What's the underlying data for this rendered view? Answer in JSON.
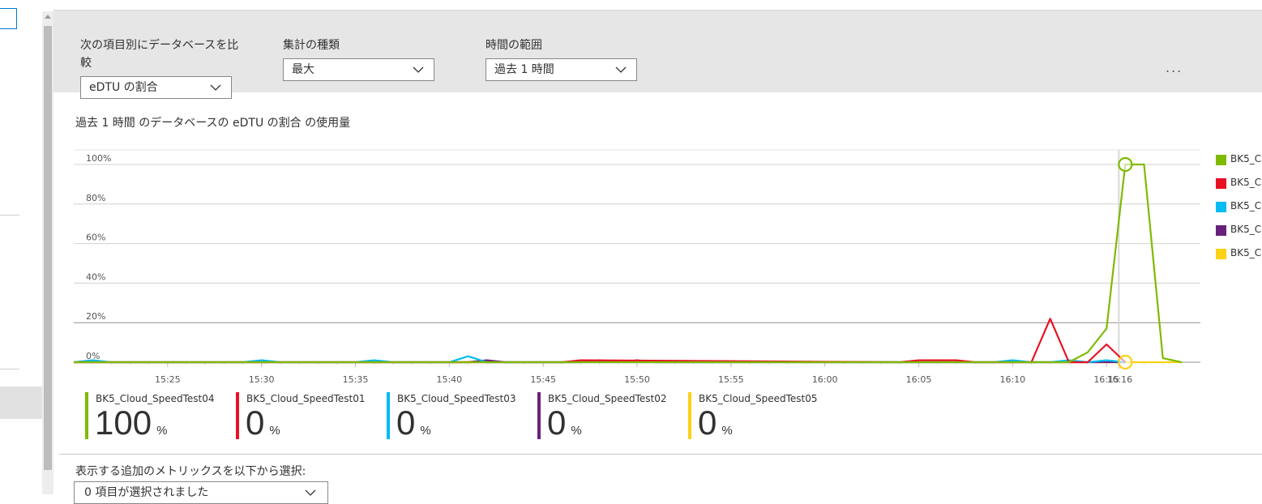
{
  "controls": {
    "compare": {
      "label": "次の項目別にデータベースを比較",
      "value": "eDTU の割合"
    },
    "aggregation": {
      "label": "集計の種類",
      "value": "最大"
    },
    "timerange": {
      "label": "時間の範囲",
      "value": "過去 1 時間"
    },
    "more": "..."
  },
  "chart_title": "過去 1 時間 のデータベースの eDTU の割合 の使用量",
  "chart_data": {
    "type": "line",
    "ylim": [
      0,
      100
    ],
    "yticks": [
      "100%",
      "80%",
      "60%",
      "40%",
      "20%",
      "0%"
    ],
    "xticks": [
      "15:25",
      "15:30",
      "15:35",
      "15:40",
      "15:45",
      "15:50",
      "15:55",
      "16:00",
      "16:05",
      "16:10",
      "16:15",
      "16:16"
    ],
    "cursor_label": "16:16",
    "grid": true,
    "legend_position": "right",
    "series": [
      {
        "name": "BK5_Cloud_SpeedTest04",
        "color": "#7fba00",
        "points": [
          [
            "15:20",
            0
          ],
          [
            "16:12",
            0
          ],
          [
            "16:13",
            0
          ],
          [
            "16:14",
            5
          ],
          [
            "16:15",
            17
          ],
          [
            "16:16",
            100
          ],
          [
            "16:17",
            100
          ],
          [
            "16:18",
            2
          ],
          [
            "16:19",
            0
          ]
        ]
      },
      {
        "name": "BK5_Cloud_SpeedTest01",
        "color": "#e81123",
        "points": [
          [
            "15:20",
            0
          ],
          [
            "15:46",
            0
          ],
          [
            "15:47",
            1
          ],
          [
            "16:04",
            0
          ],
          [
            "16:05",
            1
          ],
          [
            "16:07",
            1
          ],
          [
            "16:08",
            0
          ],
          [
            "16:11",
            0
          ],
          [
            "16:12",
            22
          ],
          [
            "16:13",
            0
          ],
          [
            "16:14",
            0
          ],
          [
            "16:15",
            9
          ],
          [
            "16:16",
            0
          ]
        ]
      },
      {
        "name": "BK5_Cloud_SpeedTest03",
        "color": "#00bcf2",
        "points": [
          [
            "15:20",
            0
          ],
          [
            "15:21",
            1
          ],
          [
            "15:22",
            0
          ],
          [
            "15:29",
            0
          ],
          [
            "15:30",
            1
          ],
          [
            "15:31",
            0
          ],
          [
            "15:35",
            0
          ],
          [
            "15:36",
            1
          ],
          [
            "15:37",
            0
          ],
          [
            "15:40",
            0
          ],
          [
            "15:41",
            3
          ],
          [
            "15:42",
            0
          ],
          [
            "16:09",
            0
          ],
          [
            "16:10",
            1
          ],
          [
            "16:11",
            0
          ],
          [
            "16:12",
            0
          ],
          [
            "16:13",
            1
          ],
          [
            "16:14",
            0
          ],
          [
            "16:15",
            1
          ],
          [
            "16:16",
            0
          ]
        ]
      },
      {
        "name": "BK5_Cloud_SpeedTest02",
        "color": "#68217a",
        "points": [
          [
            "15:20",
            0
          ],
          [
            "15:41",
            0
          ],
          [
            "15:42",
            1
          ],
          [
            "15:43",
            0
          ],
          [
            "15:47",
            0
          ],
          [
            "15:48",
            1
          ],
          [
            "15:49",
            0
          ],
          [
            "15:50",
            1
          ],
          [
            "15:51",
            0
          ],
          [
            "16:16",
            0
          ]
        ]
      },
      {
        "name": "BK5_Cloud_SpeedTest05",
        "color": "#fcd116",
        "points": [
          [
            "15:20",
            0
          ],
          [
            "16:19",
            0
          ]
        ]
      }
    ],
    "highlight": [
      {
        "series": "BK5_Cloud_SpeedTest04",
        "x": "16:16",
        "y": 100
      },
      {
        "series": "BK5_Cloud_SpeedTest05",
        "x": "16:16",
        "y": 0
      }
    ]
  },
  "legend": [
    {
      "label": "BK5_Cloud_SpeedTest04",
      "color": "#7fba00"
    },
    {
      "label": "BK5_Cloud_SpeedTest01",
      "color": "#e81123"
    },
    {
      "label": "BK5_Cloud_SpeedTest03",
      "color": "#00bcf2"
    },
    {
      "label": "BK5_Cloud_SpeedTest02",
      "color": "#68217a"
    },
    {
      "label": "BK5_Cloud_SpeedTest05",
      "color": "#fcd116"
    }
  ],
  "tiles": [
    {
      "name": "BK5_Cloud_SpeedTest04",
      "value": "100",
      "unit": "%",
      "color": "#7fba00"
    },
    {
      "name": "BK5_Cloud_SpeedTest01",
      "value": "0",
      "unit": "%",
      "color": "#e81123"
    },
    {
      "name": "BK5_Cloud_SpeedTest03",
      "value": "0",
      "unit": "%",
      "color": "#00bcf2"
    },
    {
      "name": "BK5_Cloud_SpeedTest02",
      "value": "0",
      "unit": "%",
      "color": "#68217a"
    },
    {
      "name": "BK5_Cloud_SpeedTest05",
      "value": "0",
      "unit": "%",
      "color": "#fcd116"
    }
  ],
  "additional": {
    "label": "表示する追加のメトリックスを以下から選択:",
    "value": "0 項目が選択されました"
  }
}
